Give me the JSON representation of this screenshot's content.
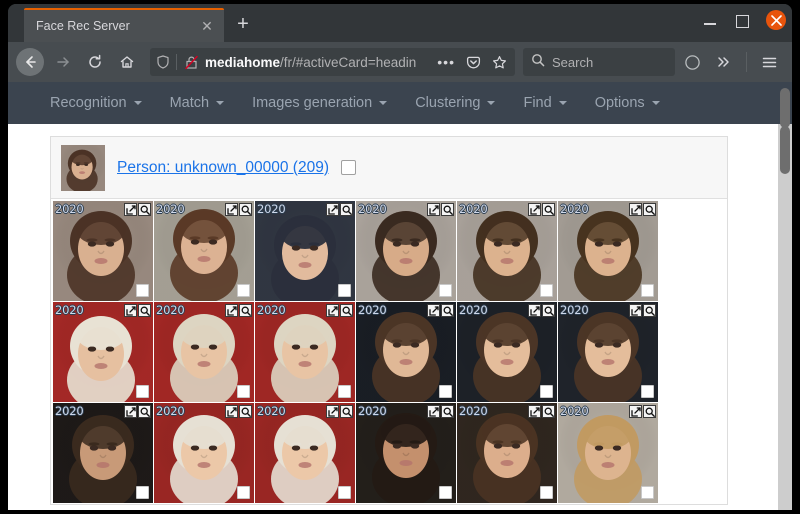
{
  "browser": {
    "tab": {
      "title": "Face Rec Server",
      "close_icon": "close-icon"
    },
    "newtab_label": "+",
    "window_controls": {
      "minimize": "minimize-icon",
      "maximize": "maximize-icon",
      "close": "close-icon"
    },
    "toolbar": {
      "back_icon": "back-arrow-icon",
      "forward_icon": "forward-arrow-icon",
      "reload_icon": "reload-icon",
      "home_icon": "home-icon",
      "shield_icon": "shield-icon",
      "lock_broken_icon": "lock-slash-icon",
      "url_host": "mediahome",
      "url_path": "/fr/#activeCard=headin",
      "page_actions_icon": "ellipsis-icon",
      "pocket_icon": "pocket-icon",
      "bookmark_icon": "star-icon",
      "search_placeholder": "Search",
      "search_icon": "search-icon",
      "account_icon": "account-circle-icon",
      "overflow_icon": "chevron-double-right-icon",
      "menu_icon": "hamburger-menu-icon"
    },
    "accent_color": "#e66000"
  },
  "app": {
    "nav": [
      {
        "label": "Recognition",
        "has_caret": true
      },
      {
        "label": "Match",
        "has_caret": true
      },
      {
        "label": "Images generation",
        "has_caret": true
      },
      {
        "label": "Clustering",
        "has_caret": true
      },
      {
        "label": "Find",
        "has_caret": true
      },
      {
        "label": "Options",
        "has_caret": true
      }
    ],
    "card": {
      "avatar_name": "person-avatar",
      "person_label": "Person: unknown_00000 (209)",
      "select_checkbox": "person-select-checkbox"
    },
    "thumb_tools": {
      "open_icon": "open-external-icon",
      "zoom_icon": "magnifier-icon",
      "select_icon": "thumbnail-select-checkbox"
    },
    "thumbnails": [
      {
        "year": "2020",
        "subject": "woman-profile-dark-hair"
      },
      {
        "year": "2020",
        "subject": "woman-smiling-leaning"
      },
      {
        "year": "2020",
        "subject": "child-hood-dark-coat"
      },
      {
        "year": "2020",
        "subject": "woman-portrait-front"
      },
      {
        "year": "2020",
        "subject": "woman-portrait-front-2"
      },
      {
        "year": "2020",
        "subject": "woman-portrait-front-3"
      },
      {
        "year": "2020",
        "subject": "girl-knit-hat-red"
      },
      {
        "year": "2020",
        "subject": "girl-knit-hat-red-2"
      },
      {
        "year": "2020",
        "subject": "girl-knit-hat-red-3"
      },
      {
        "year": "2020",
        "subject": "boy-blue-jacket"
      },
      {
        "year": "2020",
        "subject": "boy-blue-jacket-2"
      },
      {
        "year": "2020",
        "subject": "boy-blue-jacket-3"
      },
      {
        "year": "2020",
        "subject": "woman-night-portrait"
      },
      {
        "year": "2020",
        "subject": "girl-white-hood-tissue"
      },
      {
        "year": "2020",
        "subject": "girl-white-hood-tissue-2"
      },
      {
        "year": "2020",
        "subject": "woman-dark-smiling"
      },
      {
        "year": "2020",
        "subject": "woman-portrait-warm"
      },
      {
        "year": "2020",
        "subject": "girl-laughing-blonde"
      }
    ],
    "scrollbar": {
      "name": "page-vertical-scrollbar"
    }
  }
}
